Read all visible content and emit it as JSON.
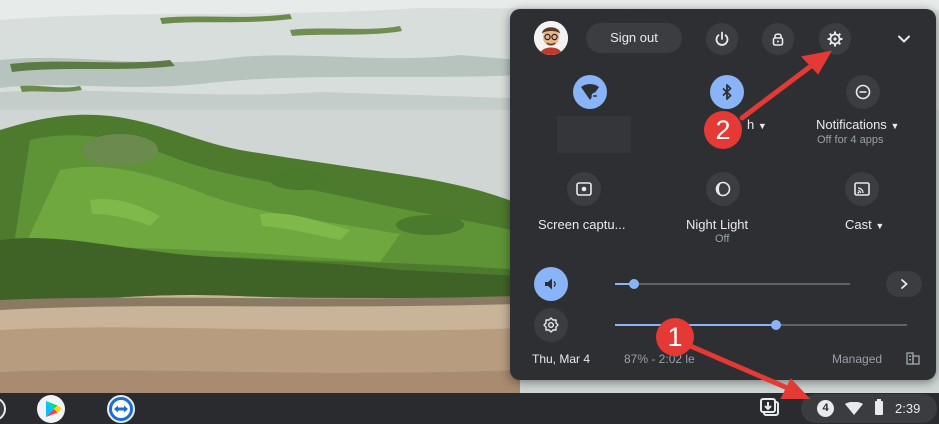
{
  "quick_settings": {
    "sign_out_label": "Sign out",
    "tiles": [
      {
        "label": "",
        "sublabel": ""
      },
      {
        "label": "h",
        "sublabel": ""
      },
      {
        "label": "Notifications",
        "sublabel": "Off for 4 apps"
      },
      {
        "label": "Screen captu...",
        "sublabel": ""
      },
      {
        "label": "Night Light",
        "sublabel": "Off"
      },
      {
        "label": "Cast",
        "sublabel": ""
      }
    ],
    "volume_level": 0.08,
    "brightness_level": 0.55,
    "footer": {
      "date": "Thu, Mar 4",
      "battery": "87% - 2:02 le",
      "managed": "Managed"
    }
  },
  "shelf": {
    "notification_count": "4",
    "time": "2:39"
  },
  "annotations": {
    "callout_1": "1",
    "callout_2": "2"
  },
  "colors": {
    "panel": "#2e2f33",
    "accent": "#8ab4f8",
    "callout": "#e53935"
  }
}
